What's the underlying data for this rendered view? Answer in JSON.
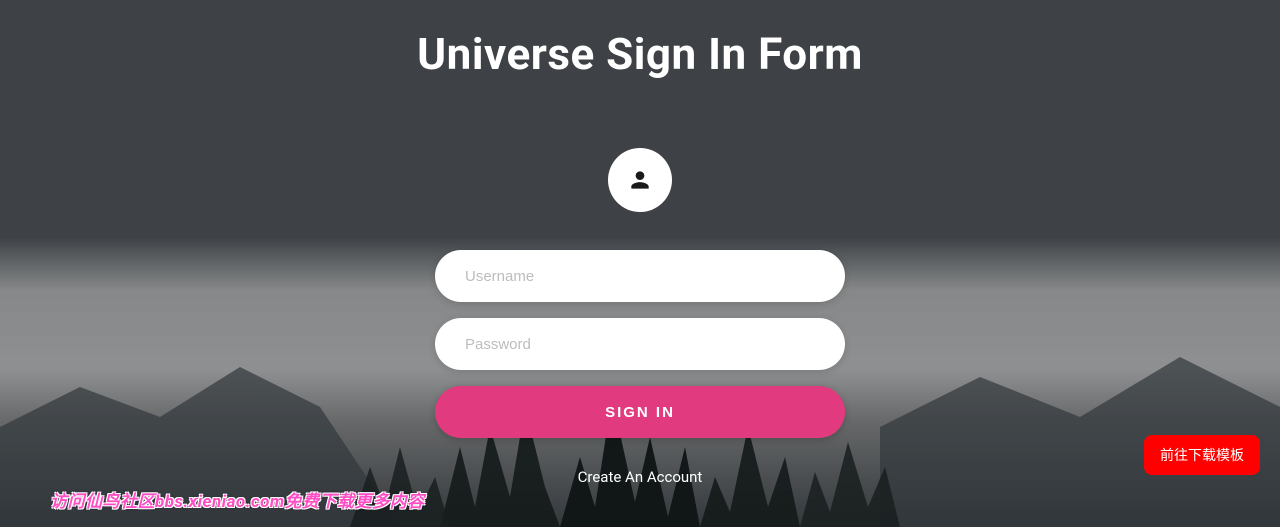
{
  "title": "Universe Sign In Form",
  "form": {
    "username_placeholder": "Username",
    "password_placeholder": "Password",
    "signin_label": "SIGN IN"
  },
  "links": {
    "create_account": "Create An Account"
  },
  "download_button": "前往下载模板",
  "watermark": "访问仙鸟社区bbs.xieniao.com免费下载更多内容"
}
